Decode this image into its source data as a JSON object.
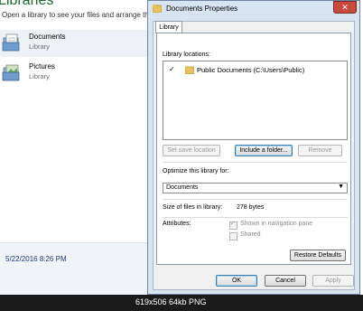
{
  "background_window": {
    "title": "Libraries",
    "subtitle": "Open a library to see your files and arrange them",
    "items": [
      {
        "name": "Documents",
        "type": "Library"
      },
      {
        "name": "Pictures",
        "type": "Library"
      }
    ],
    "status_date": "5/22/2016 8:26 PM"
  },
  "dialog": {
    "title": "Documents Properties",
    "close_label": "✕",
    "tab": "Library",
    "library_locations_label": "Library locations:",
    "location": {
      "check": "✓",
      "text": "Public Documents (C:\\Users\\Public)"
    },
    "buttons": {
      "set_save_location": "Set save location",
      "include_folder": "Include a folder...",
      "remove": "Remove",
      "restore_defaults": "Restore Defaults",
      "ok": "OK",
      "cancel": "Cancel",
      "apply": "Apply"
    },
    "optimize_label": "Optimize this library for:",
    "optimize_value": "Documents",
    "size_label": "Size of files in library:",
    "size_value": "278 bytes",
    "attributes_label": "Attributes:",
    "attr_shown": "Shown in navigation pane",
    "attr_shared": "Shared"
  },
  "caption": "619x506  64kb  PNG",
  "colors": {
    "title_green": "#1e6b2c",
    "dialog_frame": "#d7e4f2",
    "close_red": "#c94a3c"
  }
}
